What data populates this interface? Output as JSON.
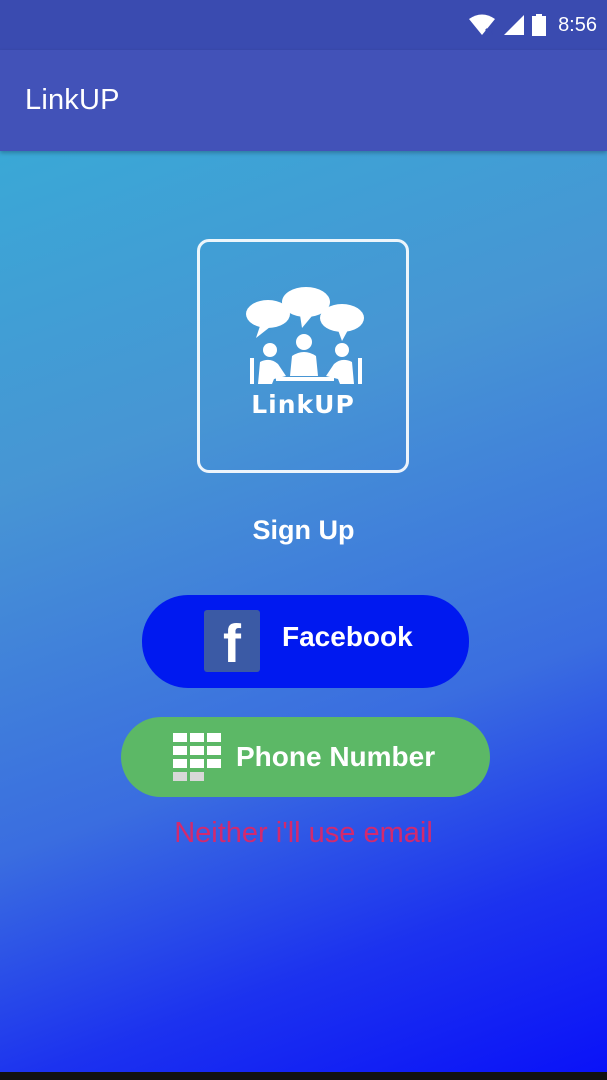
{
  "status_bar": {
    "time": "8:56",
    "icons": [
      "wifi-icon",
      "signal-icon",
      "battery-icon"
    ]
  },
  "app_bar": {
    "title": "LinkUP"
  },
  "logo": {
    "text": "LinkUP",
    "icon": "people-chat-logo-icon"
  },
  "sign_up": {
    "heading": "Sign Up",
    "facebook_label": "Facebook",
    "facebook_icon": "facebook-icon",
    "phone_label": "Phone Number",
    "phone_icon": "grid-keypad-icon",
    "email_link": "Neither i'll use email"
  },
  "colors": {
    "status_bar": "#3a4bb0",
    "app_bar": "#4252b8",
    "facebook_button": "#0019f0",
    "phone_button": "#5cb866",
    "email_link": "#d22a6e",
    "gradient_start": "#3aa8d6",
    "gradient_end": "#0a12f8"
  }
}
